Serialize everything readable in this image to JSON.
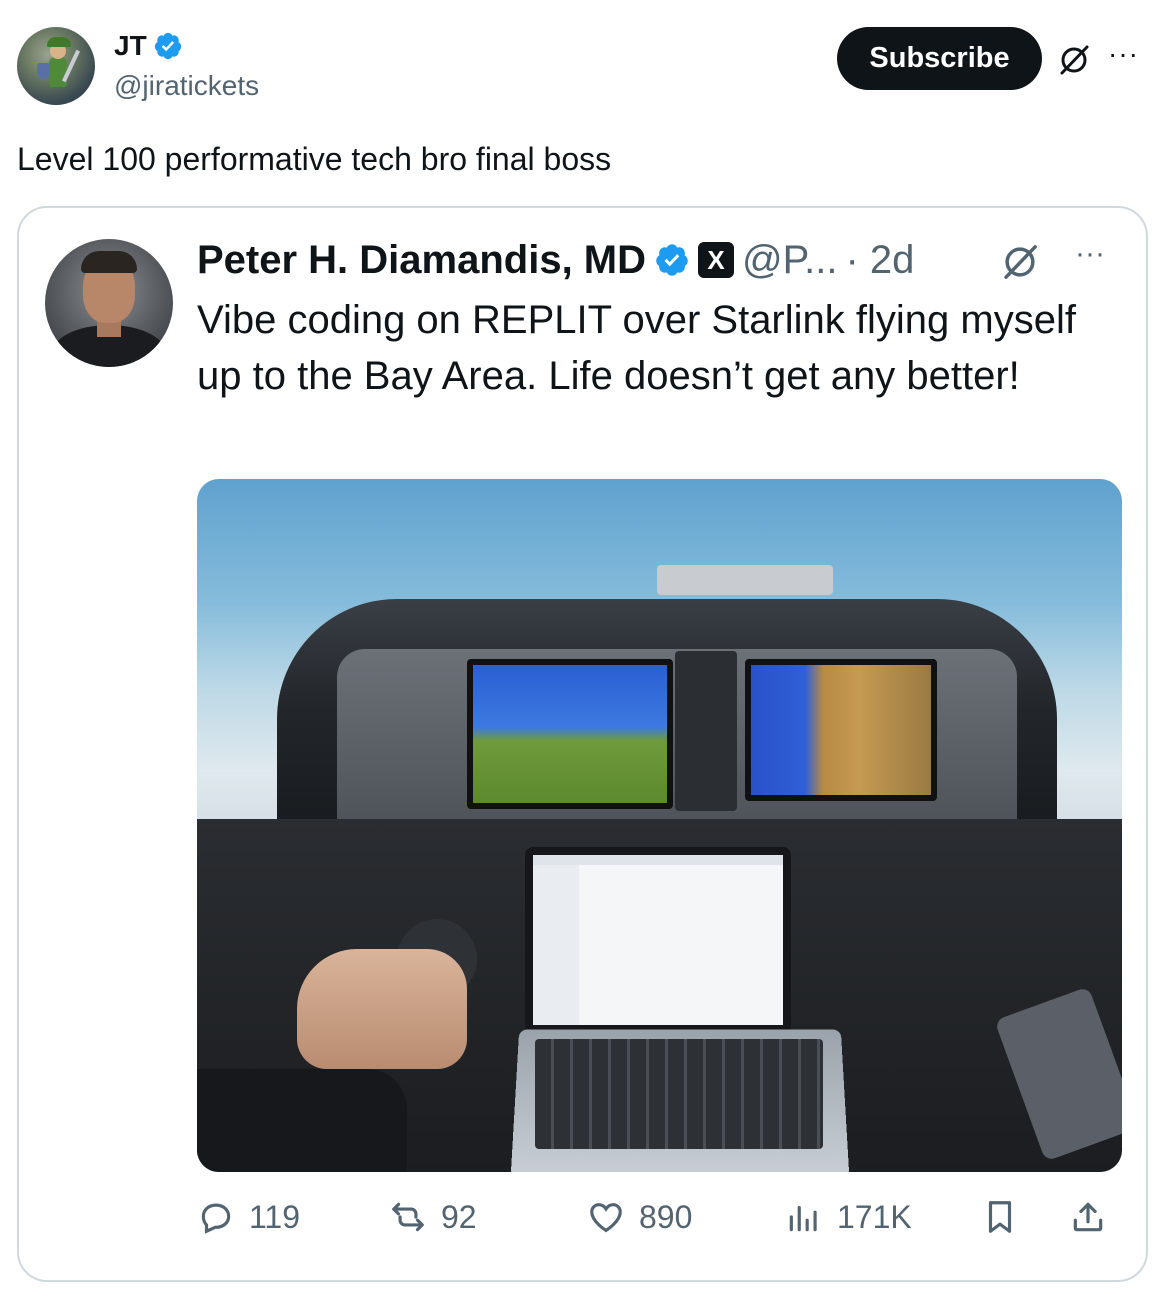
{
  "tweet": {
    "author": {
      "display_name": "JT",
      "handle": "@jiratickets",
      "verified": true
    },
    "subscribe_label": "Subscribe",
    "text": "Level 100 performative tech bro final boss"
  },
  "quoted": {
    "author": {
      "display_name": "Peter H. Diamandis, MD",
      "handle": "@P...",
      "time": "· 2d",
      "verified": true,
      "affiliate_badge": "X"
    },
    "text": "Vibe coding on REPLIT over Starlink flying myself up to the Bay Area. Life doesn’t get any better!",
    "image_description": "Cockpit photo with laptop",
    "stats": {
      "replies": "119",
      "reposts": "92",
      "likes": "890",
      "views": "171K"
    }
  },
  "colors": {
    "verified": "#1d9bf0",
    "text_primary": "#0f1419",
    "text_secondary": "#536471",
    "border": "#cfd9de",
    "subscribe_bg": "#0f1419"
  },
  "icons": {
    "more": "more-icon",
    "grok": "grok-icon",
    "reply": "reply-icon",
    "repost": "repost-icon",
    "like": "heart-icon",
    "views": "views-icon",
    "bookmark": "bookmark-icon",
    "share": "share-icon"
  }
}
